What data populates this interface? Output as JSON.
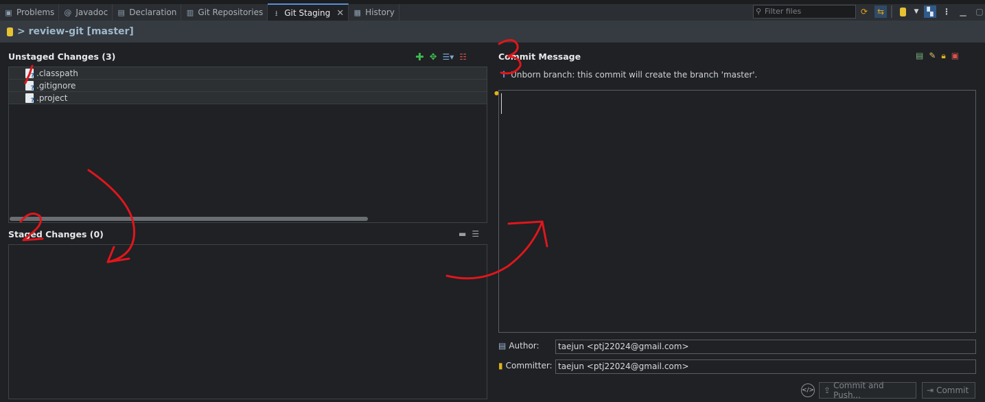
{
  "tabs": [
    {
      "label": "Problems",
      "icon": "problems-icon",
      "active": false
    },
    {
      "label": "Javadoc",
      "icon": "javadoc-icon",
      "active": false
    },
    {
      "label": "Declaration",
      "icon": "declaration-icon",
      "active": false
    },
    {
      "label": "Git Repositories",
      "icon": "git-repositories-icon",
      "active": false
    },
    {
      "label": "Git Staging",
      "icon": "git-staging-icon",
      "active": true
    },
    {
      "label": "History",
      "icon": "history-icon",
      "active": false
    }
  ],
  "toolbar": {
    "filter_placeholder": "Filter files"
  },
  "repo": {
    "title": "> review-git [master]"
  },
  "unstaged": {
    "title": "Unstaged Changes (3)",
    "files": [
      ".classpath",
      ".gitignore",
      ".project"
    ]
  },
  "staged": {
    "title": "Staged Changes (0)"
  },
  "commit": {
    "title": "Commit Message",
    "info": "Unborn branch: this commit will create the branch 'master'.",
    "message": "",
    "author_label": "Author:",
    "author_value": "taejun <ptj22024@gmail.com>",
    "committer_label": "Committer:",
    "committer_value": "taejun <ptj22024@gmail.com>",
    "commit_and_push_label": "Commit and Push...",
    "commit_label": "Commit"
  },
  "annotations": {
    "one": "1",
    "two": "2",
    "three": "3"
  },
  "colors": {
    "annotation": "#e0161c",
    "accent": "#5a8fd8",
    "repo_title": "#9fb8cc"
  }
}
